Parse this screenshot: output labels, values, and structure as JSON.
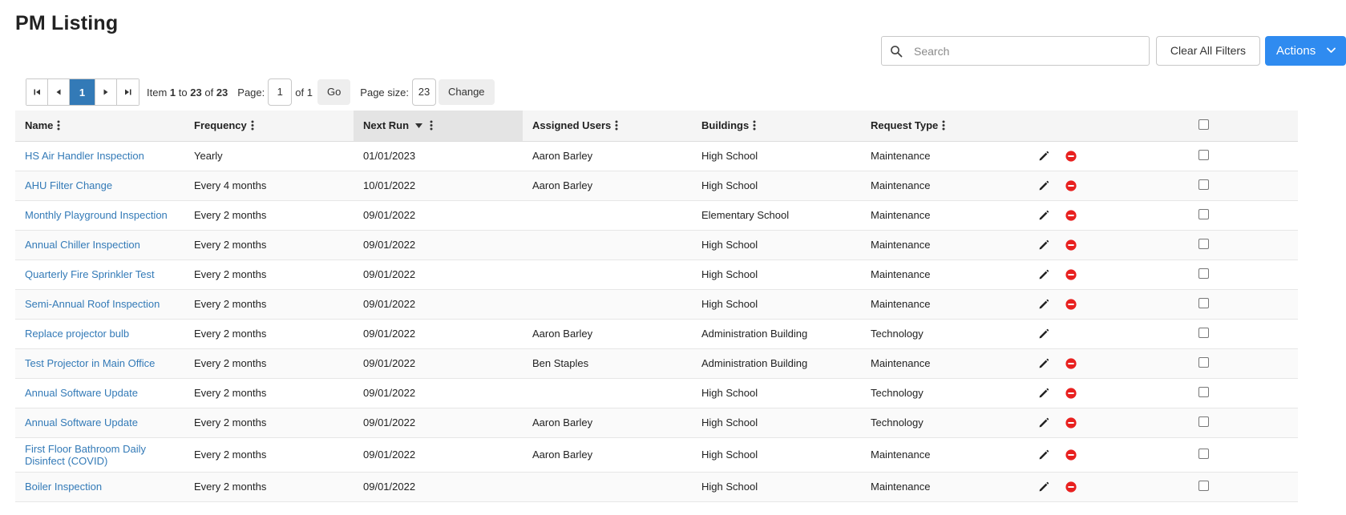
{
  "page": {
    "title": "PM Listing"
  },
  "toolbar": {
    "search_placeholder": "Search",
    "search_value": "",
    "clear_label": "Clear All Filters",
    "actions_label": "Actions",
    "accent_color": "#2f8bf0"
  },
  "pager": {
    "current_page": "1",
    "item_prefix": "Item",
    "item_from": "1",
    "item_to_word": "to",
    "item_to": "23",
    "item_of_word": "of",
    "item_total": "23",
    "page_label": "Page:",
    "page_value": "1",
    "page_of": "of 1",
    "go_label": "Go",
    "size_label": "Page size:",
    "size_value": "23",
    "change_label": "Change"
  },
  "columns": {
    "name": "Name",
    "frequency": "Frequency",
    "next_run": "Next Run",
    "assigned": "Assigned Users",
    "buildings": "Buildings",
    "request_type": "Request Type"
  },
  "rows": [
    {
      "name": "HS Air Handler Inspection",
      "frequency": "Yearly",
      "next_run": "01/01/2023",
      "assigned": "Aaron Barley",
      "building": "High School",
      "type": "Maintenance",
      "deletable": true
    },
    {
      "name": "AHU Filter Change",
      "frequency": "Every 4 months",
      "next_run": "10/01/2022",
      "assigned": "Aaron Barley",
      "building": "High School",
      "type": "Maintenance",
      "deletable": true
    },
    {
      "name": "Monthly Playground Inspection",
      "frequency": "Every 2 months",
      "next_run": "09/01/2022",
      "assigned": "",
      "building": "Elementary School",
      "type": "Maintenance",
      "deletable": true
    },
    {
      "name": "Annual Chiller Inspection",
      "frequency": "Every 2 months",
      "next_run": "09/01/2022",
      "assigned": "",
      "building": "High School",
      "type": "Maintenance",
      "deletable": true
    },
    {
      "name": "Quarterly Fire Sprinkler Test",
      "frequency": "Every 2 months",
      "next_run": "09/01/2022",
      "assigned": "",
      "building": "High School",
      "type": "Maintenance",
      "deletable": true
    },
    {
      "name": "Semi-Annual Roof Inspection",
      "frequency": "Every 2 months",
      "next_run": "09/01/2022",
      "assigned": "",
      "building": "High School",
      "type": "Maintenance",
      "deletable": true
    },
    {
      "name": "Replace projector bulb",
      "frequency": "Every 2 months",
      "next_run": "09/01/2022",
      "assigned": "Aaron Barley",
      "building": "Administration Building",
      "type": "Technology",
      "deletable": false
    },
    {
      "name": "Test Projector in Main Office",
      "frequency": "Every 2 months",
      "next_run": "09/01/2022",
      "assigned": "Ben Staples",
      "building": "Administration Building",
      "type": "Maintenance",
      "deletable": true
    },
    {
      "name": "Annual Software Update",
      "frequency": "Every 2 months",
      "next_run": "09/01/2022",
      "assigned": "",
      "building": "High School",
      "type": "Technology",
      "deletable": true
    },
    {
      "name": "Annual Software Update",
      "frequency": "Every 2 months",
      "next_run": "09/01/2022",
      "assigned": "Aaron Barley",
      "building": "High School",
      "type": "Technology",
      "deletable": true
    },
    {
      "name": "First Floor Bathroom Daily Disinfect (COVID)",
      "frequency": "Every 2 months",
      "next_run": "09/01/2022",
      "assigned": "Aaron Barley",
      "building": "High School",
      "type": "Maintenance",
      "deletable": true,
      "tall": true
    },
    {
      "name": "Boiler Inspection",
      "frequency": "Every 2 months",
      "next_run": "09/01/2022",
      "assigned": "",
      "building": "High School",
      "type": "Maintenance",
      "deletable": true
    }
  ],
  "icons": {
    "search": "magnifier-icon",
    "edit": "pencil-icon",
    "delete": "minus-circle-icon",
    "delete_color": "#e8201f",
    "link_color": "#337ab7"
  }
}
